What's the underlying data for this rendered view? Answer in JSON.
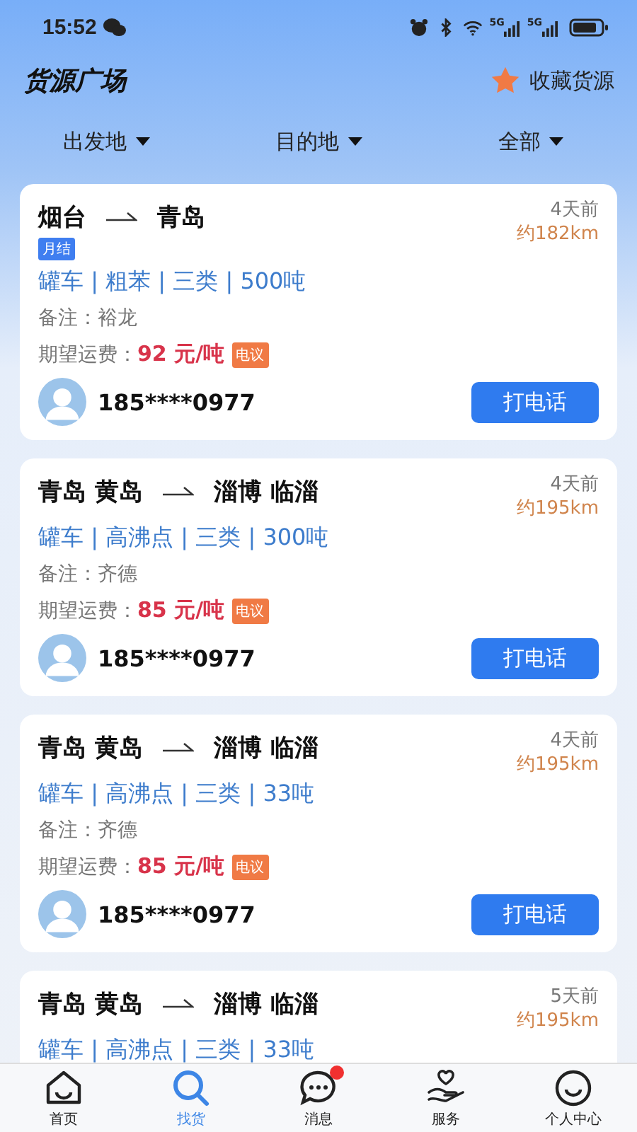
{
  "status_bar": {
    "time": "15:52",
    "signal_1": "5G",
    "signal_2": "5G"
  },
  "header": {
    "title": "货源广场",
    "favorite": "收藏货源"
  },
  "filters": [
    {
      "label": "出发地"
    },
    {
      "label": "目的地"
    },
    {
      "label": "全部"
    }
  ],
  "cards": [
    {
      "from": "烟台",
      "to": "青岛",
      "tag": "月结",
      "time": "4天前",
      "distance": "约182km",
      "specs": "罐车 | 粗苯 | 三类 | 500吨",
      "note": "备注：裕龙",
      "price_label": "期望运费：",
      "price": "92 元/吨",
      "price_badge": "电议",
      "phone": "185****0977",
      "button": "打电话"
    },
    {
      "from": "青岛 黄岛",
      "to": "淄博 临淄",
      "time": "4天前",
      "distance": "约195km",
      "specs": "罐车 | 高沸点 | 三类 | 300吨",
      "note": "备注：齐德",
      "price_label": "期望运费：",
      "price": "85 元/吨",
      "price_badge": "电议",
      "phone": "185****0977",
      "button": "打电话"
    },
    {
      "from": "青岛 黄岛",
      "to": "淄博 临淄",
      "time": "4天前",
      "distance": "约195km",
      "specs": "罐车 | 高沸点 | 三类 | 33吨",
      "note": "备注：齐德",
      "price_label": "期望运费：",
      "price": "85 元/吨",
      "price_badge": "电议",
      "phone": "185****0977",
      "button": "打电话"
    },
    {
      "from": "青岛 黄岛",
      "to": "淄博 临淄",
      "time": "5天前",
      "distance": "约195km",
      "specs": "罐车 | 高沸点 | 三类 | 33吨"
    }
  ],
  "tabs": [
    {
      "kind": "home",
      "label": "首页",
      "selected": false,
      "dot": false
    },
    {
      "kind": "search",
      "label": "找货",
      "selected": true,
      "dot": false
    },
    {
      "kind": "message",
      "label": "消息",
      "selected": false,
      "dot": true
    },
    {
      "kind": "service",
      "label": "服务",
      "selected": false,
      "dot": false
    },
    {
      "kind": "profile",
      "label": "个人中心",
      "selected": false,
      "dot": false
    }
  ]
}
